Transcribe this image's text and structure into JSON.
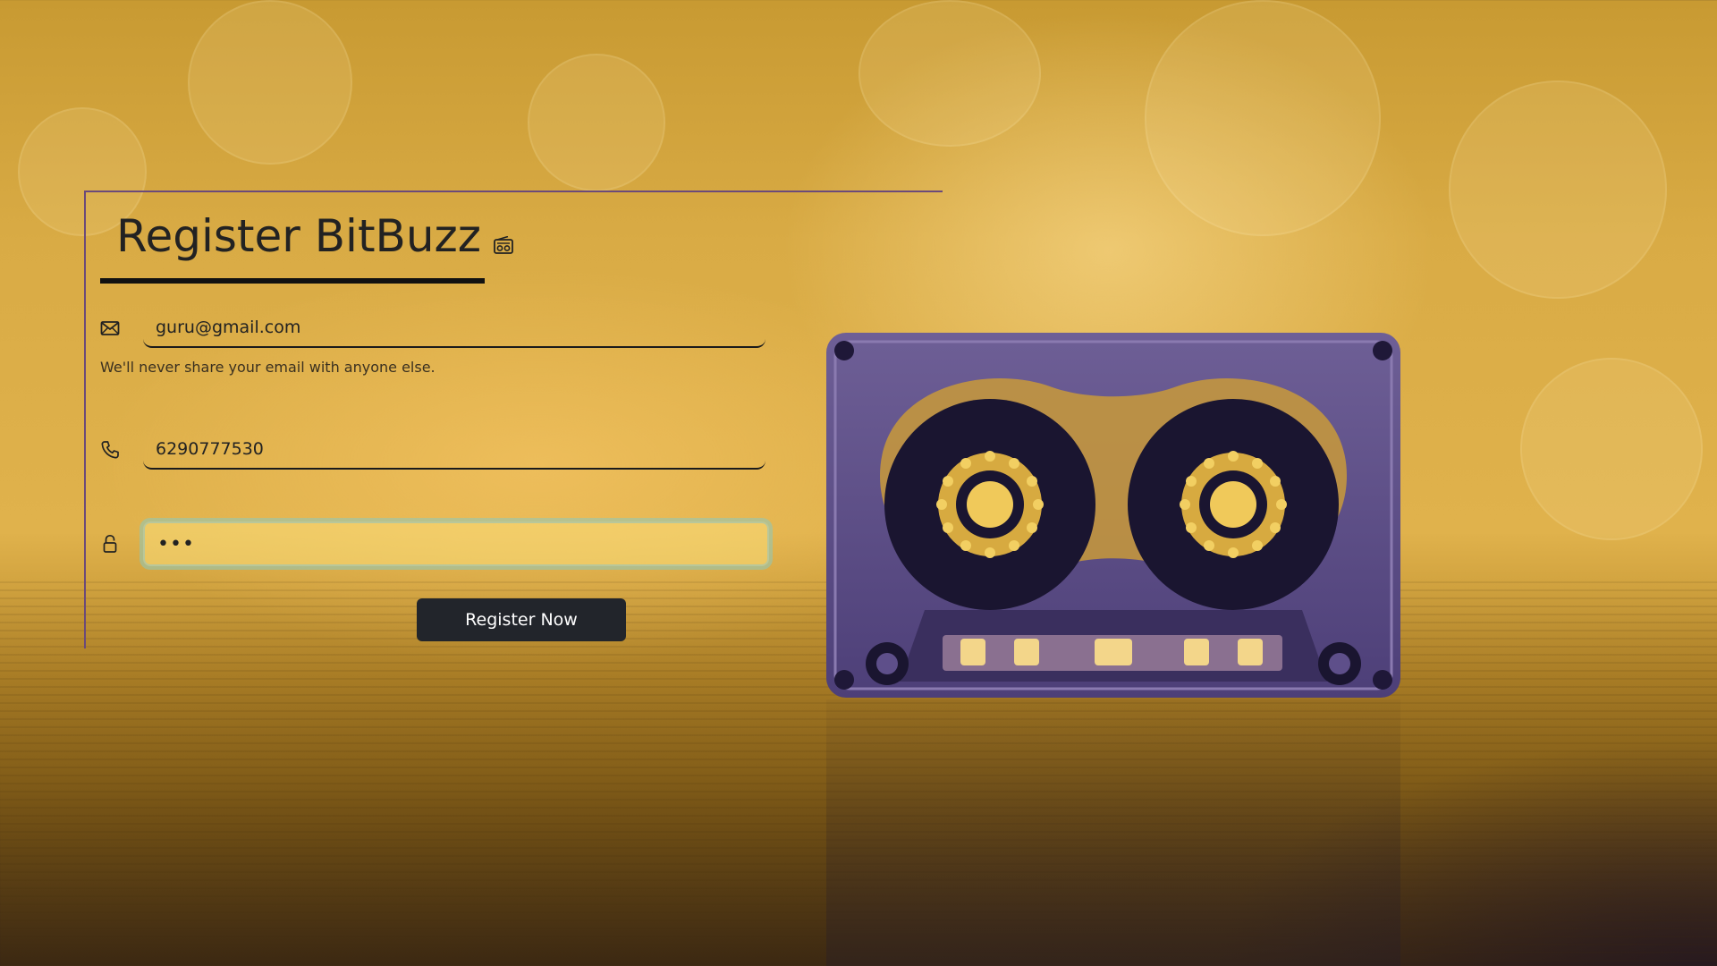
{
  "page": {
    "title": "Register BitBuzz",
    "title_icon": "radio-icon"
  },
  "form": {
    "email": {
      "icon": "envelope-icon",
      "value": "guru@gmail.com",
      "help": "We'll never share your email with anyone else."
    },
    "phone": {
      "icon": "phone-icon",
      "value": "6290777530"
    },
    "password": {
      "icon": "lock-icon",
      "value": "•••"
    },
    "submit_label": "Register Now"
  },
  "colors": {
    "background": "#d9ab45",
    "button": "#22252b",
    "button_text": "#ffffff",
    "card_border": "#6b4a7a",
    "focus_ring": "#8cc8be",
    "cassette": "#5e4f8a"
  },
  "decor": {
    "hero_image": "cassette-tape"
  }
}
